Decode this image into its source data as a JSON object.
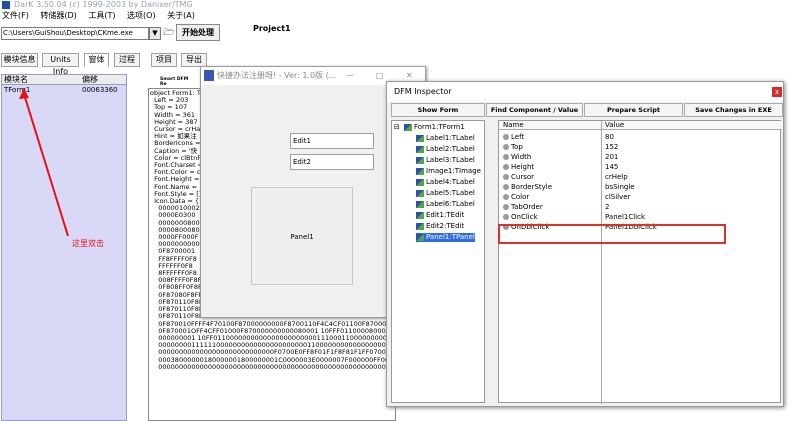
{
  "app": {
    "title": "DarK 3.50.04 (c) 1999-2003 by Danixer/TMG"
  },
  "menu": [
    "文件(F)",
    "转储器(D)",
    "工具(T)",
    "选项(O)",
    "关于(A)"
  ],
  "toolbar": {
    "path_value": "C:\\Users\\GuiShou\\Desktop\\CKme.exe",
    "process_button": "开始处理",
    "project_label": "Project1"
  },
  "tabs": [
    "模块信息",
    "Units Info",
    "窗体",
    "过程",
    "项目",
    "导出"
  ],
  "module_list": {
    "headers": [
      "模块名",
      "偏移"
    ],
    "rows": [
      {
        "name": "TForm1",
        "offset": "00063360"
      }
    ]
  },
  "annotation": {
    "text": "这里双击",
    "color": "#e81010"
  },
  "dfm_text": {
    "header": "Smart DFM Re",
    "lines": [
      "object Form1: T",
      "  Left = 203",
      "  Top = 107",
      "  Width = 361",
      "  Height = 387",
      "  Cursor = crHa",
      "  Hint = 如果注",
      "  BorderIcons =",
      "  Caption = '快",
      "  Color = clBtnF",
      "  Font.Charset =",
      "  Font.Color = c",
      "  Font.Height =",
      "  Font.Name =",
      "  Font.Style = []",
      "  Icon.Data = {",
      "    0000010002",
      "    0000E0300",
      "    0000000800",
      "    0000800080",
      "    0000FF000F",
      "    0000000000",
      "    0F8700001",
      "    FF8FFFF0F8",
      "    FFFFFF0F8",
      "    8FFFFFF0F8",
      "    008FFFF0F8FFFFF870FFFF70000000000000F08FFF0F8FFFF870FF87070000",
      "    0F808FF0F8FFFF870FF7087000000000F8708F0F8FFF870F70F870000",
      "    0F87080F8FFFF870700F87000000000F870100F8FFFF870010F870000",
      "    0F870110F8FFFF870110F870000000F870110F8FFFF870110F870000",
      "    0F870110F8FFFF870110F870000000F870110F8FFFF870110F870000",
      "    0F870110F8FFFF870110F870000000F870110F8FFFF870110F870000",
      "    0F870010FFFF4F70100F87000000000F8700110F4C4CF01100F870000",
      "    0F870001OFF4CFF01000F870000000000080001 10FFF011000080000",
      "    000000001 10FF0110000000000000000000000111000110000000000",
      "    0000000011111100000000000000000000001100000000000000000",
      "    0000000000000000000000000000F0700E0FF8F01F1F8F81F1FF0700E0FC000",
      "    00038000000180000001800000001C0000003E0000007F000000FF000000FF000",
      "    0000000000000000000000000000000000000000000000000000000000000000"
    ]
  },
  "form1": {
    "caption": "快捷办法注册呀! - Ver: 1.0版 (...",
    "win_min": "—",
    "win_max": "□",
    "win_close": "✕",
    "edit1": "Edit1",
    "edit2": "Edit2",
    "panel": "Panel1"
  },
  "inspector": {
    "title": "DFM Inspector",
    "close": "x",
    "buttons": [
      "Show Form",
      "Find Component / Value",
      "Prepare Script",
      "Save Changes in EXE"
    ],
    "tree": [
      {
        "label": "Form1:TForm1",
        "selected": false
      },
      {
        "label": "Label1:TLabel",
        "selected": false
      },
      {
        "label": "Label2:TLabel",
        "selected": false
      },
      {
        "label": "Label3:TLabel",
        "selected": false
      },
      {
        "label": "Image1:TImage",
        "selected": false
      },
      {
        "label": "Label4:TLabel",
        "selected": false
      },
      {
        "label": "Label5:TLabel",
        "selected": false
      },
      {
        "label": "Label6:TLabel",
        "selected": false
      },
      {
        "label": "Edit1:TEdit",
        "selected": false
      },
      {
        "label": "Edit2:TEdit",
        "selected": false
      },
      {
        "label": "Panel1:TPanel",
        "selected": true
      }
    ],
    "grid_headers": [
      "Name",
      "Value"
    ],
    "props": [
      {
        "name": "Left",
        "value": "80"
      },
      {
        "name": "Top",
        "value": "152"
      },
      {
        "name": "Width",
        "value": "201"
      },
      {
        "name": "Height",
        "value": "145"
      },
      {
        "name": "Cursor",
        "value": "crHelp"
      },
      {
        "name": "BorderStyle",
        "value": "bsSingle"
      },
      {
        "name": "Color",
        "value": "clSilver"
      },
      {
        "name": "TabOrder",
        "value": "2"
      },
      {
        "name": "OnClick",
        "value": "Panel1Click"
      },
      {
        "name": "OnDblClick",
        "value": "Panel1DblClick"
      }
    ],
    "highlight_color": "#d9332b"
  }
}
